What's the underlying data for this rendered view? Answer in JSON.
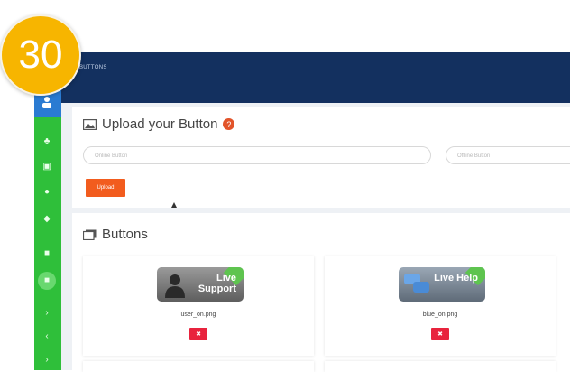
{
  "badge": {
    "number": "30"
  },
  "topbar": {
    "title": "BUTTONS"
  },
  "upload": {
    "heading": "Upload your Button",
    "online_placeholder": "Online Button",
    "offline_placeholder": "Offline Button",
    "upload_label": "Upload"
  },
  "buttons_section": {
    "heading": "Buttons",
    "items": [
      {
        "label": "Live Support",
        "filename": "user_on.png",
        "style": "gray"
      },
      {
        "label": "Live Help",
        "filename": "blue_on.png",
        "style": "blue"
      }
    ]
  },
  "colors": {
    "sidebar": "#2fbf3a",
    "topbar": "#13305f",
    "badge": "#f7b500",
    "upload_button": "#f25c1e",
    "delete_button": "#e8233d"
  }
}
